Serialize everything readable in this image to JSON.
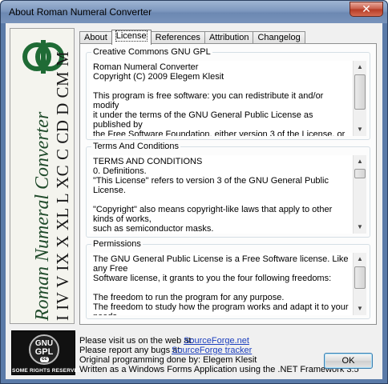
{
  "window": {
    "title": "About Roman Numeral Converter",
    "close_glyph": "✕"
  },
  "logo": {
    "icon": "roman-converter-logo-icon",
    "vertical_title": "Roman Numeral Converter",
    "vertical_numerals": "I IV V IX X XL L XC C CD D CM M",
    "colors": {
      "green": "#1f6b35",
      "text": "#1a1a1a"
    }
  },
  "tabs": [
    {
      "label": "About",
      "active": false
    },
    {
      "label": "License",
      "active": true
    },
    {
      "label": "References",
      "active": false
    },
    {
      "label": "Attribution",
      "active": false
    },
    {
      "label": "Changelog",
      "active": false
    }
  ],
  "groups": {
    "gpl": {
      "title": "Creative Commons GNU GPL",
      "text": "Roman Numeral Converter\nCopyright (C) 2009 Elegem Klesit\n\nThis program is free software: you can redistribute it and/or modify\nit under the terms of the GNU General Public License as published by\nthe Free Software Foundation, either version 3 of the License, or\n(at your option) any later version.\n\nThis program is distributed in the hope that it will be useful,\nbut WITHOUT ANY WARRANTY; without even the implied warranty of"
    },
    "terms": {
      "title": "Terms And Conditions",
      "text": "TERMS AND CONDITIONS\n0. Definitions.\n\"This License\" refers to version 3 of the GNU General Public License.\n\n\"Copyright\" also means copyright-like laws that apply to other kinds of works,\nsuch as semiconductor masks.\n\n\"The Program\" refers to any copyrightable work licensed under this License.\nEach licensee is addressed as \"you\". \"Licensees\" and \"recipients\" may be\nindividuals or organizations."
    },
    "permissions": {
      "title": "Permissions",
      "text": "The GNU General Public License is a Free Software license. Like any Free\nSoftware license, it grants to you the four following freedoms:\n\nThe freedom to run the program for any purpose.\nThe freedom to study how the program works and adapt it to your needs."
    }
  },
  "badge": {
    "gnu": "GNU",
    "gpl": "GPL",
    "cc": "cc",
    "caption": "SOME RIGHTS RESERVED"
  },
  "info": {
    "visit_label": "Please visit us on the web at:",
    "visit_link": "SourceForge.net",
    "bugs_label": "Please report any bugs at:",
    "bugs_link": "SourceForge tracker",
    "programming": "Original programming done by: Elegem Klesit",
    "framework": "Written as a Windows Forms Application using the .NET Framework 3.5"
  },
  "buttons": {
    "ok": "OK"
  }
}
